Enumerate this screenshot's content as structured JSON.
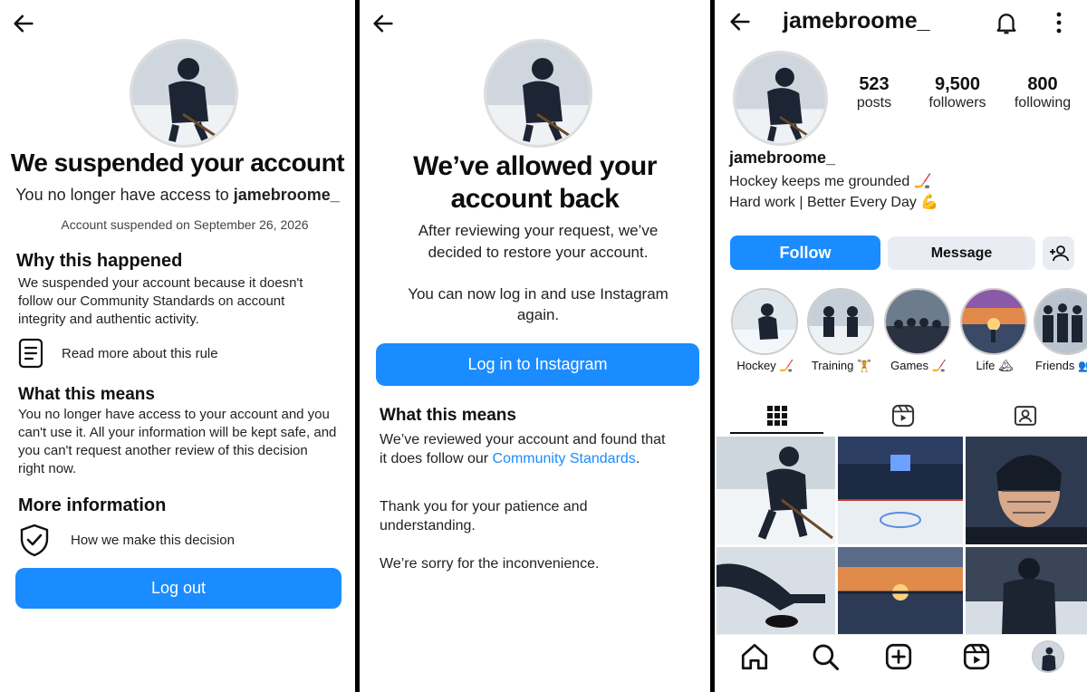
{
  "suspended": {
    "title": "We suspended your account",
    "subtitle_prefix": "You no longer have access to",
    "username": "jamebroome_",
    "suspended_date": "Account suspended on September 26, 2026",
    "why_title": "Why this happened",
    "why_body": "We suspended your account because it doesn't follow our Community Standards on account integrity and authentic activity.",
    "rule_link": "Read more about this rule",
    "means_title": "What this means",
    "means_body": "You no longer have access to your account and you can't use it. All your information will be kept safe, and you can't request another review of this decision right now.",
    "more_title": "More information",
    "decision_link": "How we make this decision",
    "logout_label": "Log out"
  },
  "restored": {
    "title_line1": "We’ve allowed your",
    "title_line2": "account back",
    "review_text": "After reviewing your request, we’ve decided to restore your account.",
    "login_text": "You can now log in and use Instagram again.",
    "login_button": "Log in to Instagram",
    "means_title": "What this means",
    "means_body_prefix": "We’ve reviewed your account and found that it does follow our",
    "standards_link": "Community Standards",
    "means_body_suffix": ".",
    "thanks": "Thank you for your patience and understanding.",
    "sorry": "We’re sorry for the inconvenience."
  },
  "profile": {
    "username": "jamebroome_",
    "name": "jamebroome_",
    "bio_line1": "Hockey keeps me grounded 🏒",
    "bio_line2": "Hard work | Better Every Day 💪",
    "stats": [
      {
        "value": "523",
        "label": "posts"
      },
      {
        "value": "9,500",
        "label": "followers"
      },
      {
        "value": "800",
        "label": "following"
      }
    ],
    "follow_label": "Follow",
    "message_label": "Message",
    "highlights": [
      {
        "label": "Hockey 🏒"
      },
      {
        "label": "Training 🏋"
      },
      {
        "label": "Games 🏒"
      },
      {
        "label": "Life 🏔"
      },
      {
        "label": "Friends 👥"
      }
    ],
    "colors": {
      "accent": "#1a8cff",
      "button_grey": "#e9edf3"
    }
  }
}
